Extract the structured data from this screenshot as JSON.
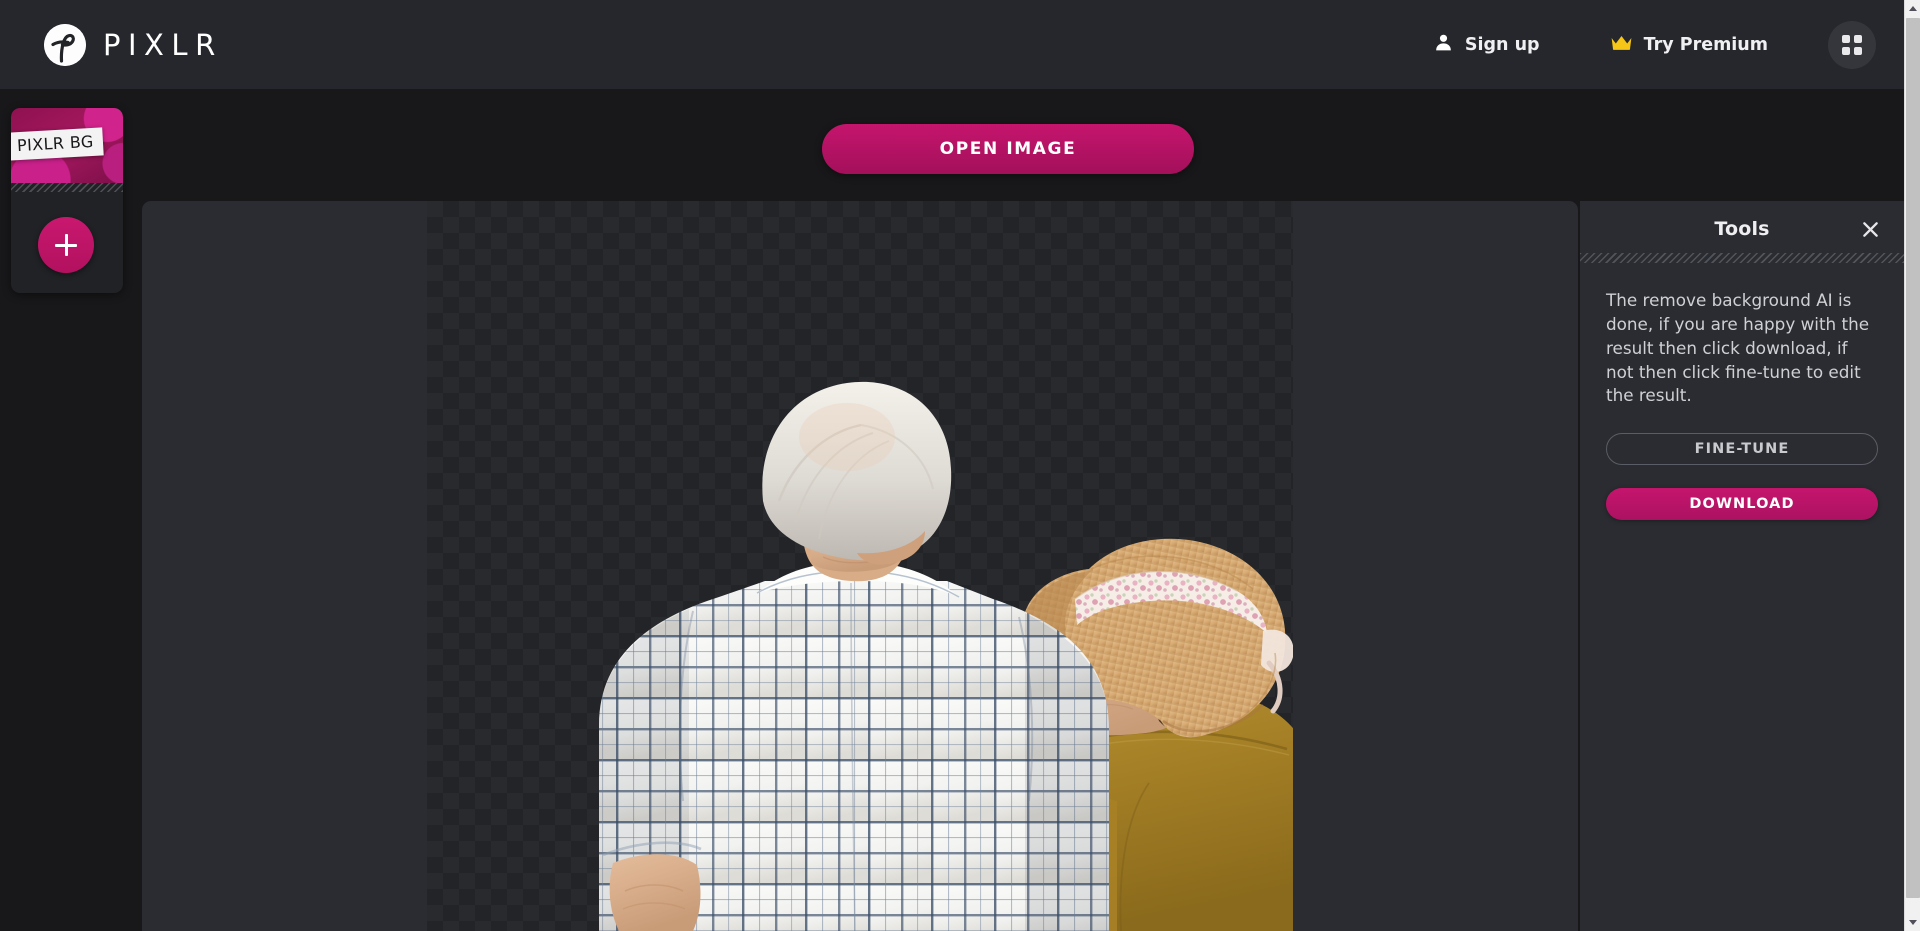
{
  "header": {
    "logo_icon": "pixlr-logo-icon",
    "logo_text": "PIXLR",
    "sign_up": {
      "label": "Sign up",
      "icon": "person-icon"
    },
    "try_premium": {
      "label": "Try Premium",
      "icon": "crown-icon",
      "icon_color": "#f5c518"
    },
    "apps_icon": "apps-grid-icon"
  },
  "left_dock": {
    "thumbnail_label": "PIXLR BG",
    "add_button_icon": "plus-icon"
  },
  "toolbar": {
    "open_image_label": "OPEN IMAGE"
  },
  "canvas": {
    "transparency_checker": true,
    "image_alt": "Elderly couple seen from behind, background removed"
  },
  "tools_panel": {
    "title": "Tools",
    "close_icon": "close-icon",
    "description": "The remove background AI is done, if you are happy with the result then click download, if not then click fine-tune to edit the result.",
    "fine_tune_label": "FINE-TUNE",
    "download_label": "DOWNLOAD"
  },
  "colors": {
    "accent": "#c5156d",
    "header_bg": "#25272c",
    "panel_bg": "#2a2c31",
    "page_bg": "#18181a",
    "premium_gold": "#f5c518"
  },
  "scrollbar": {
    "up_arrow_icon": "scroll-up-arrow-icon",
    "down_arrow_icon": "scroll-down-arrow-icon"
  }
}
